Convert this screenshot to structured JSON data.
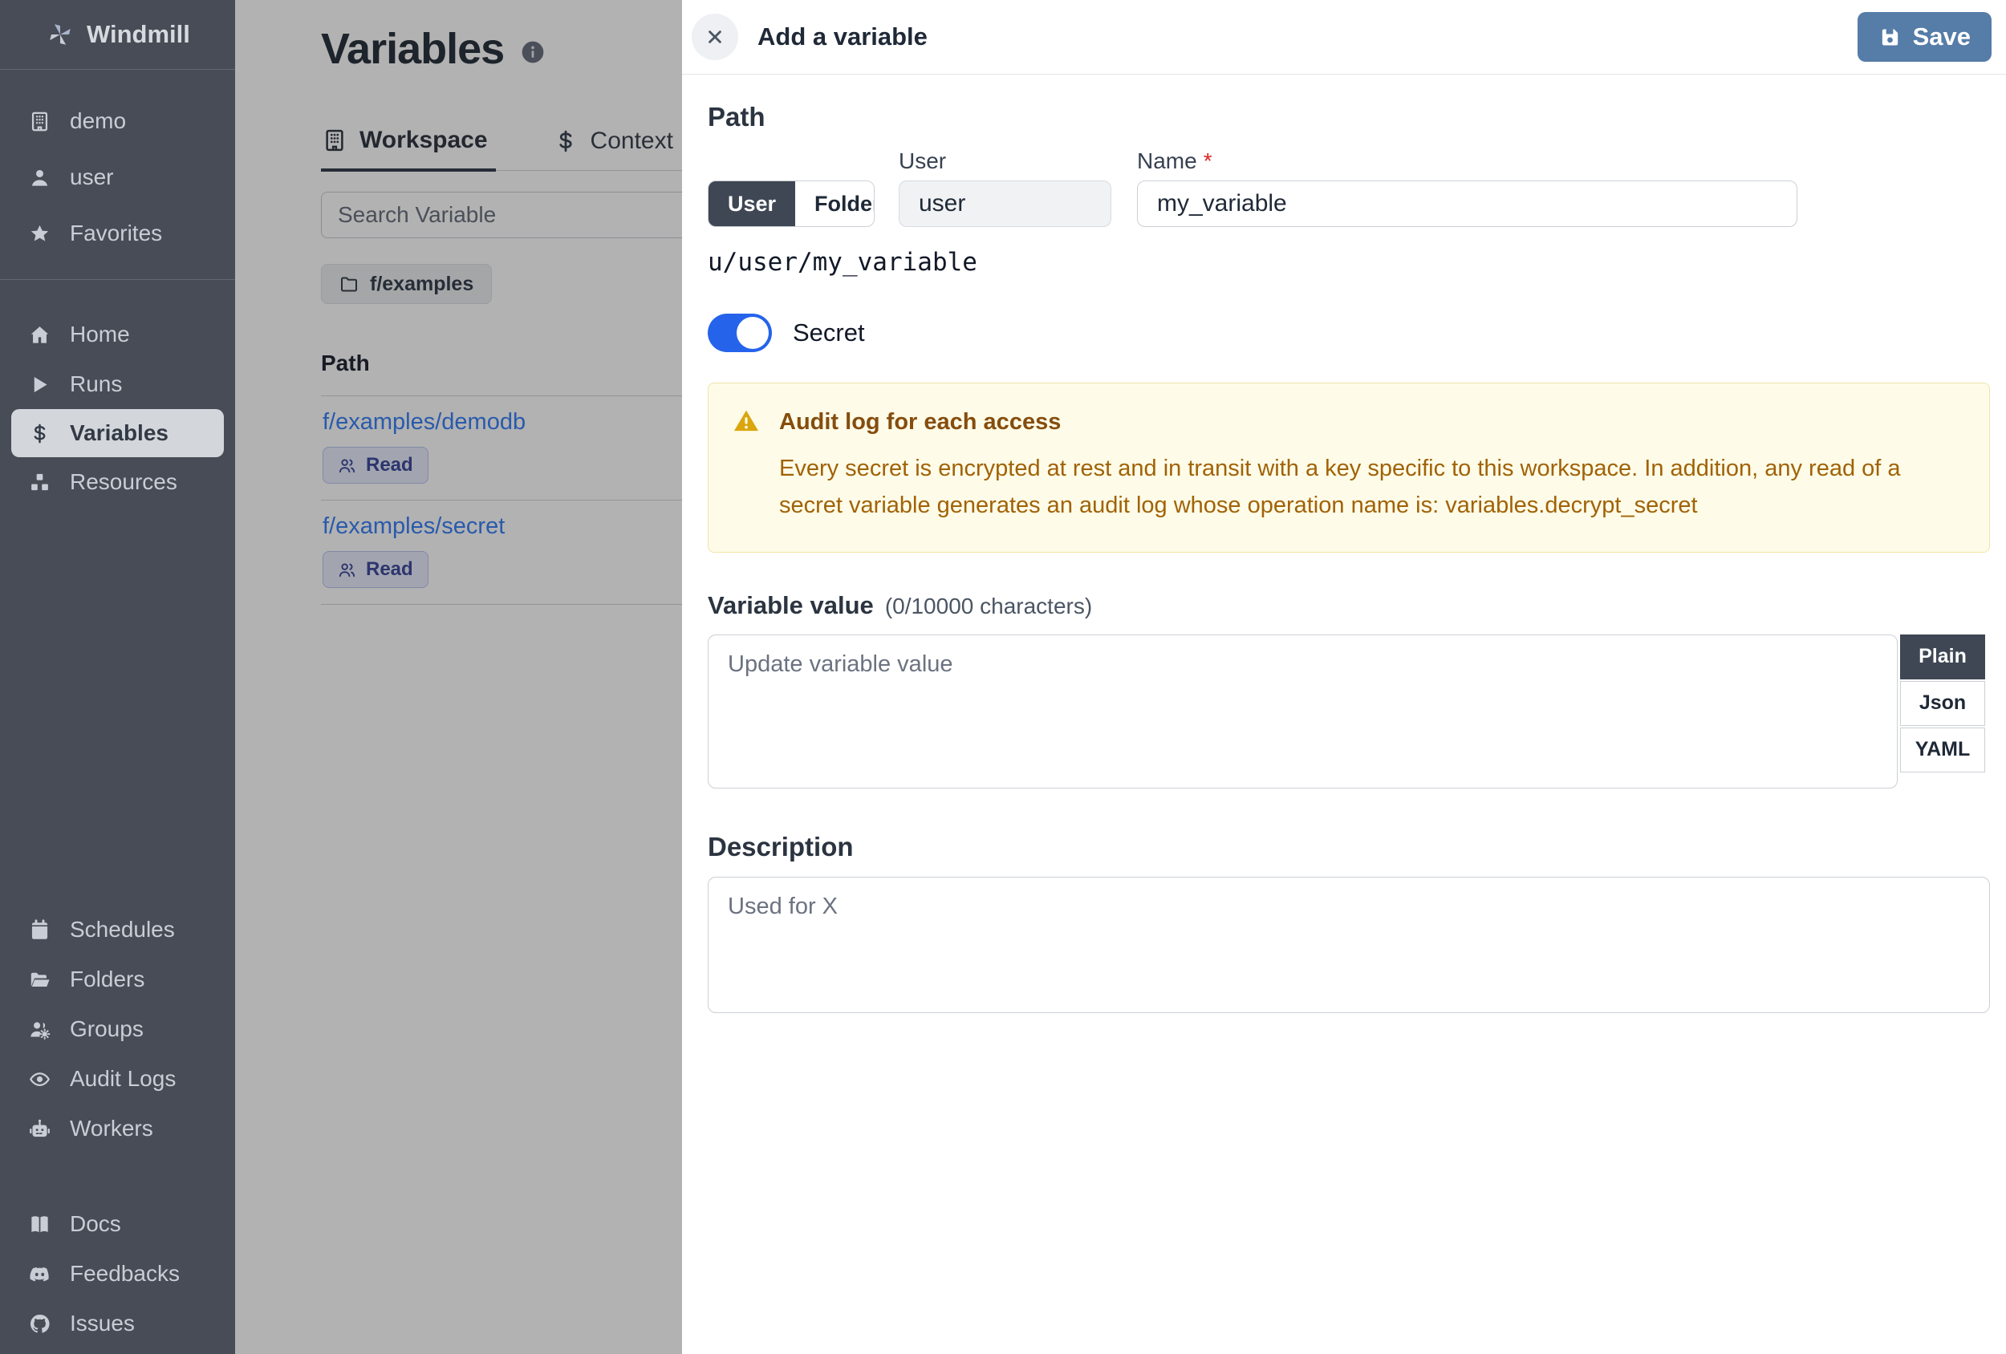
{
  "colors": {
    "accent_blue": "#2563eb",
    "save_button_blue": "#567ca8",
    "link_blue": "#3b82f6",
    "sidebar_bg": "#474c56",
    "active_pill_bg": "#d3d6db",
    "dark_segment": "#3f4754",
    "warning_bg": "#fefce8",
    "warning_title_color": "#854d0e",
    "warning_text_color": "#a16207"
  },
  "sidebar": {
    "logo": "Windmill",
    "workspace_items": [
      {
        "label": "demo",
        "icon": "building-icon"
      },
      {
        "label": "user",
        "icon": "user-icon"
      },
      {
        "label": "Favorites",
        "icon": "star-icon"
      }
    ],
    "nav_items": [
      {
        "label": "Home",
        "icon": "home-icon",
        "active": false
      },
      {
        "label": "Runs",
        "icon": "play-icon",
        "active": false
      },
      {
        "label": "Variables",
        "icon": "dollar-icon",
        "active": true
      },
      {
        "label": "Resources",
        "icon": "cubes-icon",
        "active": false
      }
    ],
    "secondary_items": [
      {
        "label": "Schedules",
        "icon": "calendar-icon"
      },
      {
        "label": "Folders",
        "icon": "folder-open-icon"
      },
      {
        "label": "Groups",
        "icon": "users-gear-icon"
      },
      {
        "label": "Audit Logs",
        "icon": "eye-icon"
      },
      {
        "label": "Workers",
        "icon": "robot-icon"
      }
    ],
    "footer_items": [
      {
        "label": "Docs",
        "icon": "book-icon"
      },
      {
        "label": "Feedbacks",
        "icon": "discord-icon"
      },
      {
        "label": "Issues",
        "icon": "github-icon"
      }
    ]
  },
  "main": {
    "title": "Variables",
    "tabs": [
      {
        "label": "Workspace",
        "icon": "building-icon",
        "active": true
      },
      {
        "label": "Context",
        "icon": "dollar-icon",
        "active": false
      }
    ],
    "search_placeholder": "Search Variable",
    "folder_chip": "f/examples",
    "list": {
      "column_header": "Path",
      "rows": [
        {
          "path": "f/examples/demodb",
          "badge": "Read"
        },
        {
          "path": "f/examples/secret",
          "badge": "Read"
        }
      ]
    }
  },
  "drawer": {
    "title": "Add a variable",
    "save_label": "Save",
    "path": {
      "heading": "Path",
      "toggle_options": [
        "User",
        "Folder"
      ],
      "toggle_selected": "User",
      "user_label": "User",
      "user_value": "user",
      "name_label": "Name",
      "required_mark": "*",
      "name_value": "my_variable",
      "preview": "u/user/my_variable"
    },
    "secret": {
      "label": "Secret",
      "enabled": true
    },
    "warning": {
      "title": "Audit log for each access",
      "body": "Every secret is encrypted at rest and in transit with a key specific to this workspace. In addition, any read of a secret variable generates an audit log whose operation name is: variables.decrypt_secret"
    },
    "value": {
      "heading": "Variable value",
      "counter": "(0/10000 characters)",
      "placeholder": "Update variable value",
      "formats": [
        "Plain",
        "Json",
        "YAML"
      ],
      "format_selected": "Plain"
    },
    "description": {
      "heading": "Description",
      "placeholder": "Used for X"
    }
  }
}
